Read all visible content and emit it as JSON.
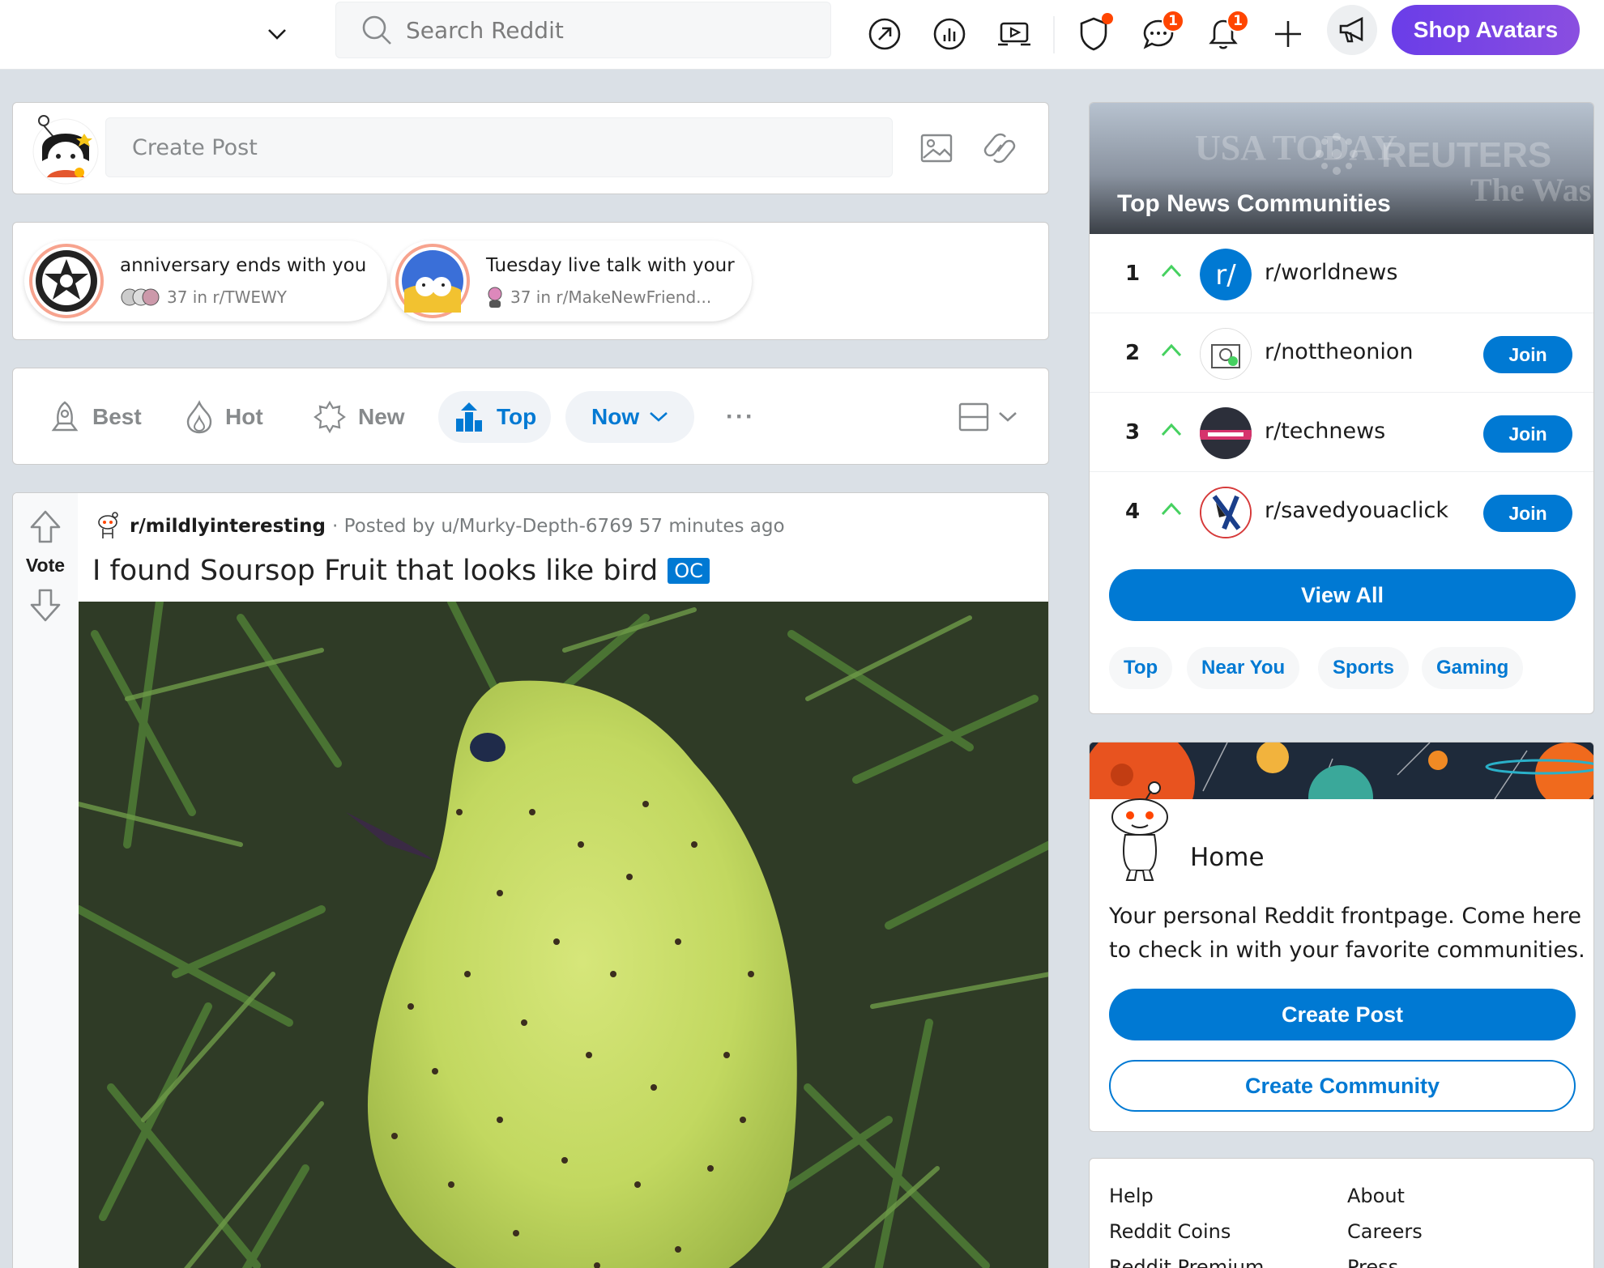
{
  "header": {
    "search_placeholder": "Search Reddit",
    "chat_badge": "1",
    "notif_badge": "1",
    "shop_label": "Shop Avatars"
  },
  "create_post": {
    "placeholder": "Create Post"
  },
  "live_talks": [
    {
      "title": "anniversary ends with you",
      "meta": "37 in r/TWEWY"
    },
    {
      "title": "Tuesday live talk with your",
      "meta": "37 in r/MakeNewFriend..."
    }
  ],
  "sort": {
    "best": "Best",
    "hot": "Hot",
    "new": "New",
    "top": "Top",
    "time": "Now",
    "more": "···"
  },
  "post": {
    "vote_label": "Vote",
    "subreddit": "r/mildlyinteresting",
    "posted_by": "· Posted by u/Murky-Depth-6769 57 minutes ago",
    "title": "I found Soursop Fruit that looks like bird",
    "flair": "OC"
  },
  "top_news": {
    "title": "Top  News  Communities",
    "banner_words": [
      "USA TODAY",
      "REUTERS",
      "The Was"
    ],
    "communities": [
      {
        "rank": "1",
        "name": "r/worldnews",
        "join": ""
      },
      {
        "rank": "2",
        "name": "r/nottheonion",
        "join": "Join"
      },
      {
        "rank": "3",
        "name": "r/technews",
        "join": "Join"
      },
      {
        "rank": "4",
        "name": "r/savedyouaclick",
        "join": "Join"
      }
    ],
    "view_all": "View All",
    "chips": [
      "Top",
      "Near You",
      "Sports",
      "Gaming"
    ]
  },
  "home": {
    "title": "Home",
    "description": "Your personal Reddit frontpage. Come here to check in with your favorite communities.",
    "create_post": "Create Post",
    "create_community": "Create Community"
  },
  "footer_links": {
    "col1": [
      "Help",
      "Reddit Coins",
      "Reddit Premium"
    ],
    "col2": [
      "About",
      "Careers",
      "Press"
    ]
  },
  "colors": {
    "accent": "#0079d3",
    "orange": "#ff4500",
    "shop": "#7b46e3"
  }
}
